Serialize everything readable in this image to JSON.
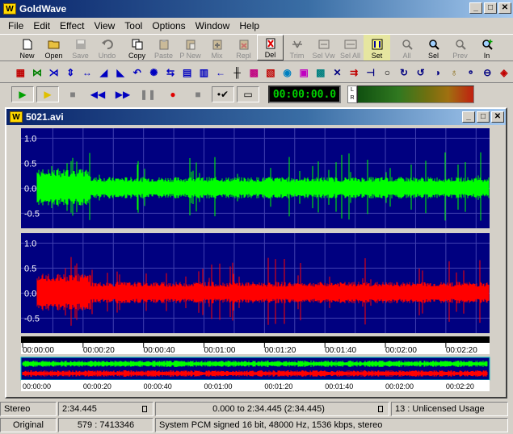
{
  "app": {
    "title": "GoldWave",
    "logo": "W",
    "window_buttons": [
      "_",
      "□",
      "✕"
    ]
  },
  "menu": [
    "File",
    "Edit",
    "Effect",
    "View",
    "Tool",
    "Options",
    "Window",
    "Help"
  ],
  "toolbar_main": [
    {
      "label": "New",
      "icon": "new-file-icon",
      "enabled": true
    },
    {
      "label": "Open",
      "icon": "open-folder-icon",
      "enabled": true
    },
    {
      "label": "Save",
      "icon": "save-disk-icon",
      "enabled": false
    },
    {
      "label": "Undo",
      "icon": "undo-icon",
      "enabled": false
    },
    {
      "label": "Copy",
      "icon": "copy-icon",
      "enabled": true
    },
    {
      "label": "Paste",
      "icon": "paste-icon",
      "enabled": false
    },
    {
      "label": "P New",
      "icon": "paste-new-icon",
      "enabled": false
    },
    {
      "label": "Mix",
      "icon": "mix-icon",
      "enabled": false
    },
    {
      "label": "Repl",
      "icon": "replace-icon",
      "enabled": false
    },
    {
      "label": "Del",
      "icon": "delete-icon",
      "enabled": true
    },
    {
      "label": "Trim",
      "icon": "trim-icon",
      "enabled": false
    },
    {
      "label": "Sel Vw",
      "icon": "select-view-icon",
      "enabled": false
    },
    {
      "label": "Sel All",
      "icon": "select-all-icon",
      "enabled": false
    },
    {
      "label": "Set",
      "icon": "set-marker-icon",
      "enabled": true
    },
    {
      "label": "All",
      "icon": "zoom-all-icon",
      "enabled": false
    },
    {
      "label": "Sel",
      "icon": "zoom-selection-icon",
      "enabled": true
    },
    {
      "label": "Prev",
      "icon": "zoom-previous-icon",
      "enabled": false
    },
    {
      "label": "In",
      "icon": "zoom-in-icon",
      "enabled": true
    }
  ],
  "transport": {
    "time": "00:00:00.0",
    "meter_l": "L",
    "meter_r": "R"
  },
  "document": {
    "title": "5021.avi",
    "y_ticks": [
      "1.0",
      "0.5",
      "0.0",
      "-0.5"
    ],
    "time_ticks": [
      "00:00:00",
      "00:00:20",
      "00:00:40",
      "00:01:00",
      "00:01:20",
      "00:01:40",
      "00:02:00",
      "00:02:20"
    ],
    "channel_colors": {
      "left": "#00ff00",
      "right": "#ff0000",
      "background": "#000080"
    }
  },
  "status": {
    "row1": {
      "channels": "Stereo",
      "length": "2:34.445",
      "selection": "0.000 to 2:34.445 (2:34.445)",
      "usage": "13 : Unlicensed Usage"
    },
    "row2": {
      "mode": "Original",
      "position": "579 : 7413346",
      "format": "System PCM signed 16 bit, 48000 Hz, 1536 kbps, stereo"
    }
  }
}
